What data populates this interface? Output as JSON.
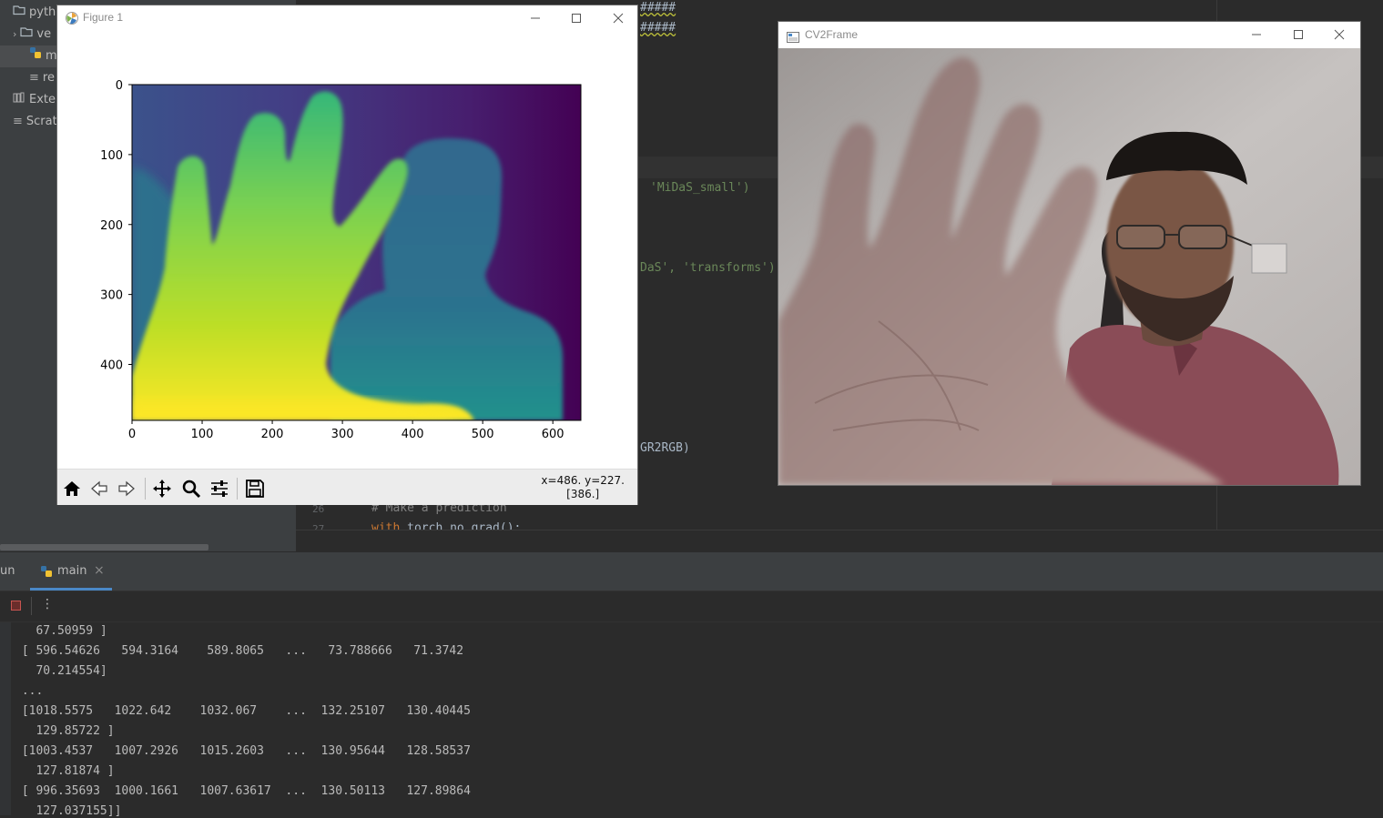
{
  "project_tree": {
    "items": [
      {
        "label": "pytho"
      },
      {
        "label": "ve"
      },
      {
        "label": "m"
      },
      {
        "label": "re"
      },
      {
        "label": "Exter"
      },
      {
        "label": "Scrat"
      }
    ]
  },
  "editor": {
    "lines": {
      "hash1": "#####",
      "hash2": "#####",
      "midas_small": "'MiDaS_small')",
      "transforms_a": "DaS', ",
      "transforms_b": "'transforms')",
      "cvt": "GR2RGB)",
      "ln26": "26",
      "ln27": "27",
      "comment": "# Make a prediction",
      "with_kw": "with",
      "with_rest": " torch.no_grad():"
    }
  },
  "figure_window": {
    "title": "Figure 1",
    "coord_line1": "x=486. y=227.",
    "coord_line2": "[386.]",
    "toolbar_icons": [
      "home-icon",
      "back-arrow-icon",
      "forward-arrow-icon",
      "move-icon",
      "zoom-icon",
      "configure-icon",
      "save-icon"
    ]
  },
  "chart_data": {
    "type": "heatmap",
    "title": "",
    "xlabel": "",
    "ylabel": "",
    "xlim": [
      0,
      640
    ],
    "ylim": [
      480,
      0
    ],
    "x_ticks": [
      "0",
      "100",
      "200",
      "300",
      "400",
      "500",
      "600"
    ],
    "y_ticks": [
      "0",
      "100",
      "200",
      "300",
      "400"
    ],
    "colormap": "viridis",
    "colors": {
      "low": "#440154",
      "mid": "#31688e",
      "high": "#fde725"
    }
  },
  "cv_window": {
    "title": "CV2Frame"
  },
  "run_panel": {
    "label": "un",
    "tab_label": "main",
    "close_glyph": "×",
    "more_glyph": "⋮",
    "console": [
      "   67.50959 ]",
      " [ 596.54626   594.3164    589.8065   ...   73.788666   71.3742",
      "   70.214554]",
      " ...",
      " [1018.5575   1022.642    1032.067    ...  132.25107   130.40445",
      "   129.85722 ]",
      " [1003.4537   1007.2926   1015.2603   ...  130.95644   128.58537",
      "   127.81874 ]",
      " [ 996.35693  1000.1661   1007.63617  ...  130.50113   127.89864",
      "   127.037155]]"
    ]
  },
  "colors": {
    "ide_bg": "#2b2b2b",
    "panel_bg": "#3c3f41",
    "string_green": "#6a8759",
    "accent_blue": "#4a88c7"
  }
}
